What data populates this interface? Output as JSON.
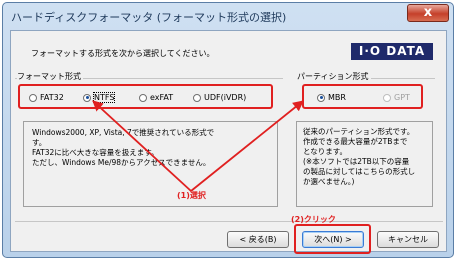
{
  "window": {
    "title": "ハードディスクフォーマッタ (フォーマット形式の選択)",
    "close_label": "x"
  },
  "instruction": "フォーマットする形式を次から選択してください。",
  "logo": "I·O DATA",
  "format_group": {
    "label": "フォーマット形式",
    "options": [
      {
        "label": "FAT32",
        "selected": false
      },
      {
        "label": "NTFS",
        "selected": true
      },
      {
        "label": "exFAT",
        "selected": false
      },
      {
        "label": "UDF(iVDR)",
        "selected": false
      }
    ]
  },
  "partition_group": {
    "label": "パーティション形式",
    "options": [
      {
        "label": "MBR",
        "selected": true
      },
      {
        "label": "GPT",
        "selected": false,
        "disabled": true
      }
    ]
  },
  "format_description": [
    "Windows2000, XP, Vista, 7で推奨されている形式で",
    "す。",
    "FAT32に比べ大きな容量を扱えます。",
    "ただし、Windows Me/98からアクセスできません。"
  ],
  "partition_description": [
    "従来のパーティション形式です。",
    "作成できる最大容量が2TBまで",
    "となります。",
    "(※本ソフトでは2TB以下の容量",
    "の製品に対してはこちらの形式し",
    "か選べません。)"
  ],
  "annotations": {
    "select": "(1)選択",
    "click": "(2)クリック"
  },
  "buttons": {
    "back": "< 戻る(B)",
    "next": "次へ(N) >",
    "cancel": "キャンセル"
  }
}
